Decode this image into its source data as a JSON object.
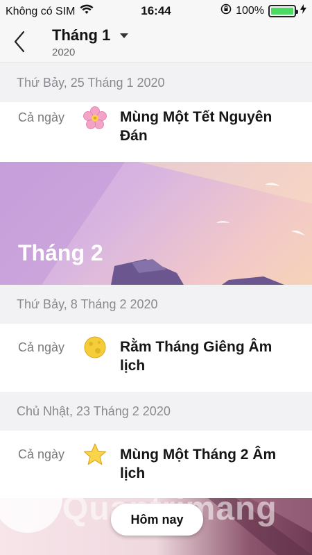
{
  "status_bar": {
    "carrier": "Không có SIM",
    "time": "16:44",
    "battery_percent": "100%",
    "battery_level": 1.0,
    "icons": [
      "wifi-icon",
      "rotation-lock-icon",
      "battery-icon",
      "charging-bolt-icon"
    ]
  },
  "nav": {
    "month": "Tháng 1",
    "year": "2020",
    "back_icon": "chevron-left-icon",
    "dropdown_icon": "caret-down-icon"
  },
  "sections": [
    {
      "date": "Thứ Bảy, 25 Tháng 1 2020",
      "events": [
        {
          "allday": "Cả ngày",
          "icon": "cherry-blossom-icon",
          "title": "Mùng Một Tết Nguyên Đán"
        }
      ]
    },
    {
      "date": "Thứ Bảy, 8 Tháng 2 2020",
      "events": [
        {
          "allday": "Cả ngày",
          "icon": "full-moon-icon",
          "title": "Rằm Tháng Giêng Âm lịch"
        }
      ]
    },
    {
      "date": "Chủ Nhật, 23 Tháng 2 2020",
      "events": [
        {
          "allday": "Cả ngày",
          "icon": "star-icon",
          "title": "Mùng Một Tháng 2 Âm lịch"
        }
      ]
    }
  ],
  "banner": {
    "title": "Tháng 2"
  },
  "today_button": "Hôm nay",
  "watermark": "Quantrimang",
  "colors": {
    "accent_text": "#111111",
    "header_bg": "#f2f2f4",
    "battery_green": "#4cd964",
    "banner_purple": "#c9a6de"
  }
}
